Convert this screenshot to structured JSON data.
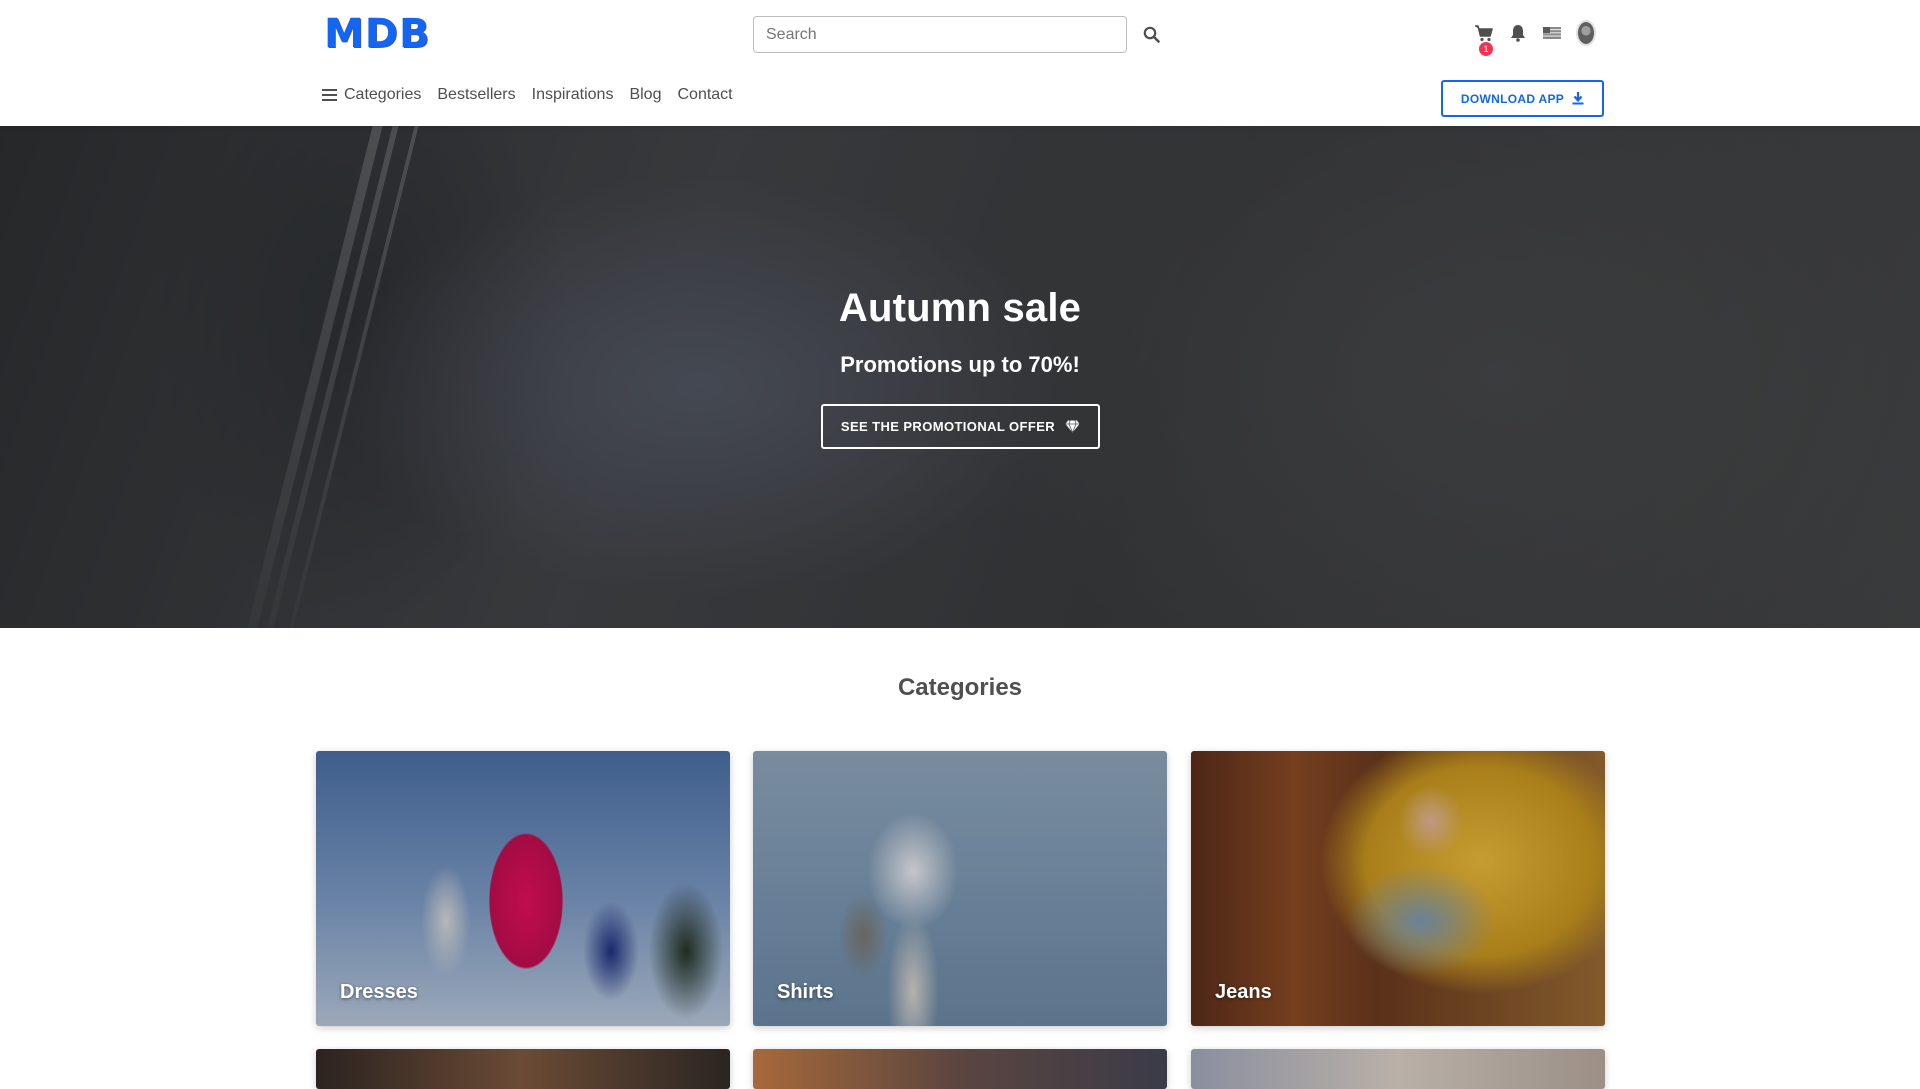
{
  "header": {
    "logo": "MDB",
    "search_placeholder": "Search",
    "cart_count": "1",
    "download_label": "DOWNLOAD APP"
  },
  "nav": {
    "items": [
      {
        "label": "Categories"
      },
      {
        "label": "Bestsellers"
      },
      {
        "label": "Inspirations"
      },
      {
        "label": "Blog"
      },
      {
        "label": "Contact"
      }
    ]
  },
  "hero": {
    "title": "Autumn sale",
    "subtitle": "Promotions up to 70%!",
    "button_label": "SEE THE PROMOTIONAL OFFER"
  },
  "categories": {
    "title": "Categories",
    "items": [
      {
        "label": "Dresses"
      },
      {
        "label": "Shirts"
      },
      {
        "label": "Jeans"
      }
    ]
  },
  "colors": {
    "accent": "#1266f1",
    "badge": "#f93154"
  }
}
